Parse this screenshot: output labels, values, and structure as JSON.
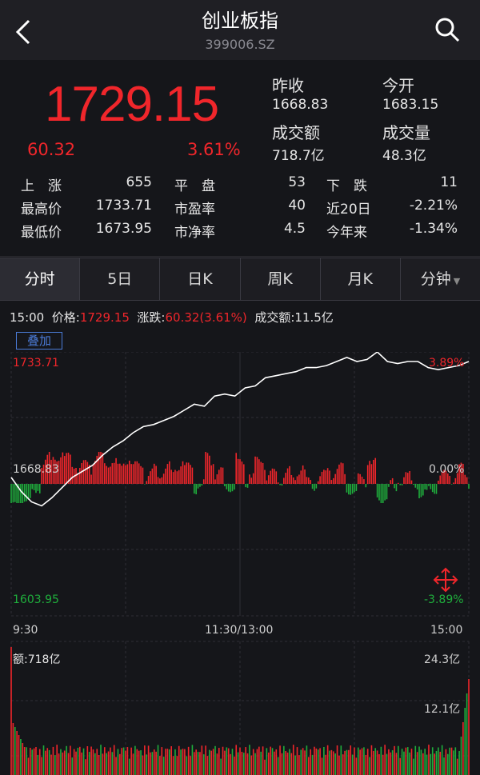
{
  "header": {
    "title": "创业板指",
    "code": "399006.SZ"
  },
  "quote": {
    "price": "1729.15",
    "change": "60.32",
    "change_pct": "3.61%",
    "prev_close_label": "昨收",
    "prev_close": "1668.83",
    "open_label": "今开",
    "open": "1683.15",
    "amount_label": "成交额",
    "amount": "718.7亿",
    "volume_label": "成交量",
    "volume": "48.3亿"
  },
  "stats": {
    "row1": {
      "a_label": "上　涨",
      "a_val": "655",
      "b_label": "平　盘",
      "b_val": "53",
      "c_label": "下　跌",
      "c_val": "11"
    },
    "row2": {
      "a_label": "最高价",
      "a_val": "1733.71",
      "b_label": "市盈率",
      "b_val": "40",
      "c_label": "近20日",
      "c_val": "-2.21%"
    },
    "row3": {
      "a_label": "最低价",
      "a_val": "1673.95",
      "b_label": "市净率",
      "b_val": "4.5",
      "c_label": "今年来",
      "c_val": "-1.34%"
    }
  },
  "tabs": [
    "分时",
    "5日",
    "日K",
    "周K",
    "月K",
    "分钟"
  ],
  "info": {
    "time": "15:00",
    "price_label": "价格:",
    "price": "1729.15",
    "chg_label": "涨跌:",
    "chg": "60.32(3.61%)",
    "amt_label": "成交额:",
    "amt": "11.5亿"
  },
  "overlay_label": "叠加",
  "chart_data": {
    "type": "line",
    "y_top_label": "1733.71",
    "y_mid_label": "1668.83",
    "y_bot_label": "1603.95",
    "pct_top": "3.89%",
    "pct_mid": "0.00%",
    "pct_bot": "-3.89%",
    "x_labels": [
      "9:30",
      "11:30/13:00",
      "15:00"
    ],
    "ylim": [
      1603.95,
      1733.71
    ],
    "price_line": [
      1672,
      1665,
      1660,
      1658,
      1662,
      1667,
      1672,
      1675,
      1678,
      1683,
      1687,
      1690,
      1694,
      1697,
      1698,
      1700,
      1702,
      1705,
      1708,
      1707,
      1712,
      1713,
      1712,
      1716,
      1717,
      1721,
      1722,
      1723,
      1724,
      1726,
      1726,
      1727,
      1729,
      1731,
      1729,
      1730,
      1733.71,
      1729,
      1728,
      1729,
      1729,
      1726,
      1725,
      1726,
      1727,
      1729
    ],
    "volume_label": "额:718亿",
    "vol_top": "24.3亿",
    "vol_mid": "12.1亿"
  },
  "colors": {
    "up": "#f0262b",
    "down": "#1fae3c",
    "bg": "#15161a",
    "grid": "#2e2e35"
  }
}
